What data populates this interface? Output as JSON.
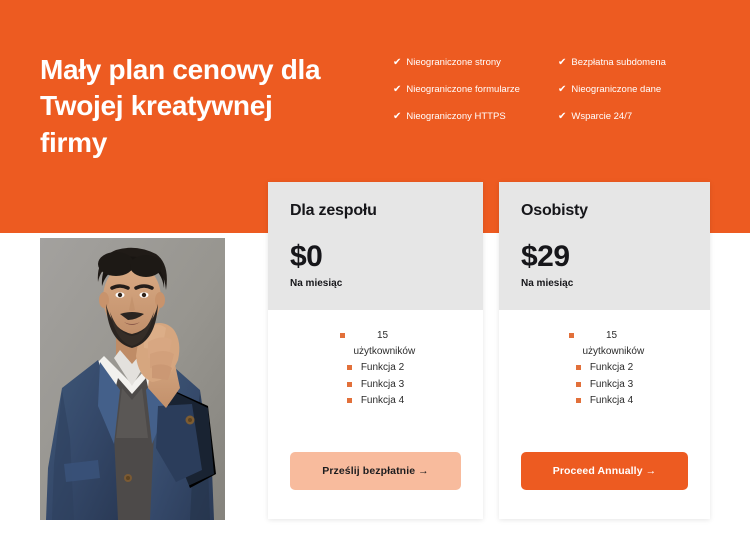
{
  "hero": {
    "heading": "Mały plan cenowy dla Twojej kreatywnej firmy",
    "background_color": "#ED5B21",
    "check_icon": "✔",
    "features_left": [
      "Nieograniczone strony",
      "Nieograniczone formularze",
      "Nieograniczony HTTPS"
    ],
    "features_right": [
      "Bezpłatna subdomena",
      "Nieograniczone dane",
      "Wsparcie 24/7"
    ]
  },
  "photo": {
    "alt": "Bearded man in blue blazer with hand raised to chin on gray backdrop"
  },
  "cards": [
    {
      "id": "team",
      "title": "Dla zespołu",
      "price": "$0",
      "period": "Na miesiąc",
      "features": [
        "15 użytkowników",
        "Funkcja 2",
        "Funkcja 3",
        "Funkcja 4"
      ],
      "cta_label": "Prześlij bezpłatnie →",
      "cta_color": "#F8BB9D",
      "header_color": "#E6E6E6"
    },
    {
      "id": "personal",
      "title": "Osobisty",
      "price": "$29",
      "period": "Na miesiąc",
      "features": [
        "15 użytkowników",
        "Funkcja 2",
        "Funkcja 3",
        "Funkcja 4"
      ],
      "cta_label": "Proceed Annually →",
      "cta_color": "#ED5B21",
      "header_color": "#E6E6E6"
    }
  ]
}
